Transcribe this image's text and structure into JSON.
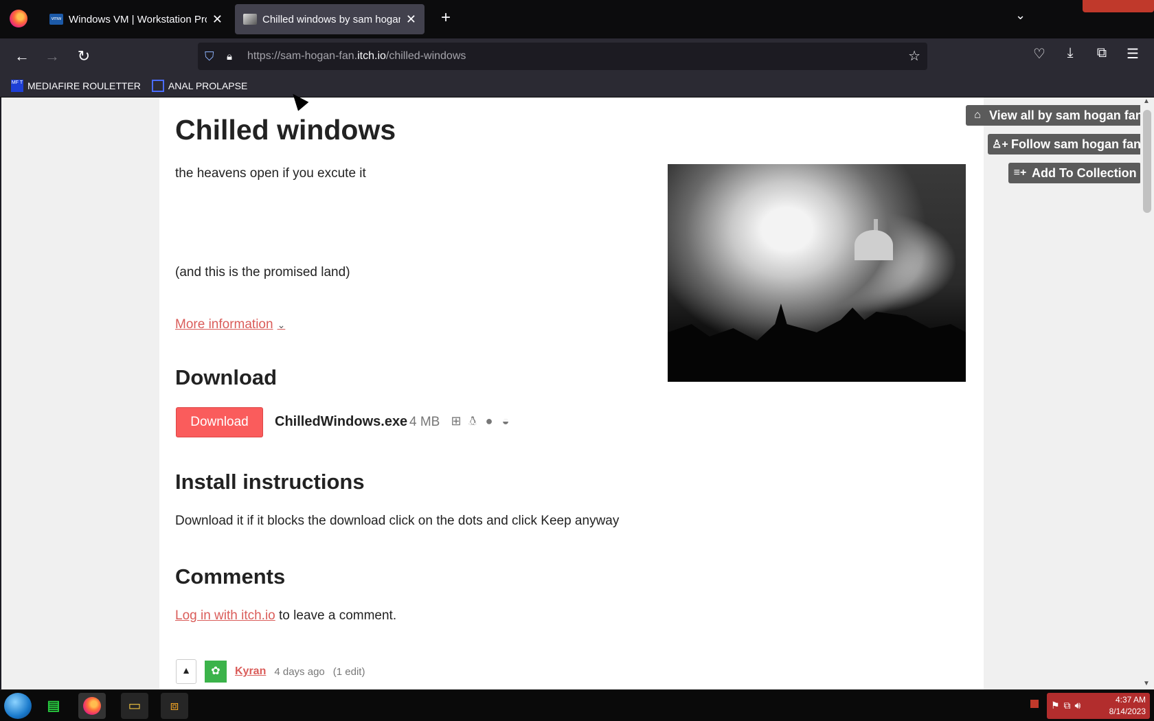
{
  "browser": {
    "tabs": [
      {
        "title": "Windows VM | Workstation Pro"
      },
      {
        "title": "Chilled windows by sam hogan"
      }
    ],
    "vmware_favicon_text": "vmw",
    "url_prefix": "https://sam-hogan-fan.",
    "url_host": "itch.io",
    "url_path": "/chilled-windows",
    "bookmarks": [
      {
        "label": "MEDIAFIRE ROULETTER",
        "icon_text": "MF T"
      },
      {
        "label": "ANAL PROLAPSE"
      }
    ]
  },
  "page": {
    "title": "Chilled windows",
    "tagline": "the heavens open if you excute it",
    "promise": "(and this is the promised land)",
    "more_info": "More information",
    "download_heading": "Download",
    "download_button": "Download",
    "file_name": "ChilledWindows.exe",
    "file_size": "4 MB",
    "platforms": [
      "windows-icon",
      "linux-icon",
      "apple-icon",
      "android-icon"
    ],
    "install_heading": "Install instructions",
    "install_text": "Download it if it blocks the download click on the dots and click Keep anyway",
    "comments_heading": "Comments",
    "login_link": "Log in with itch.io",
    "login_suffix": " to leave a comment.",
    "comment": {
      "author": "Kyran",
      "time": "4 days ago",
      "edit": "(1 edit)"
    }
  },
  "sidebar": {
    "view_all": "View all by sam hogan fan",
    "follow": "Follow sam hogan fan",
    "collection": "Add To Collection"
  },
  "taskbar": {
    "time": "4:37 AM",
    "date": "8/14/2023"
  },
  "colors": {
    "accent": "#fa5c5c",
    "link": "#da5c59",
    "side_button": "#5b5b5b"
  }
}
